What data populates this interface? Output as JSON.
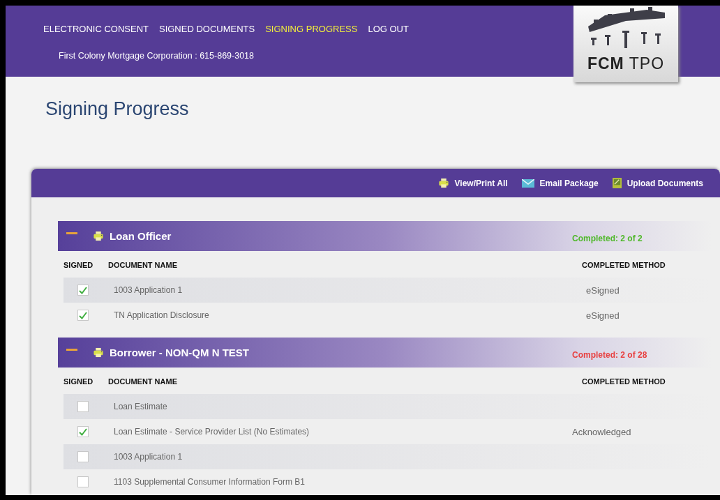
{
  "nav": [
    {
      "label": "ELECTRONIC CONSENT",
      "selected": false
    },
    {
      "label": "SIGNED DOCUMENTS",
      "selected": false
    },
    {
      "label": "SIGNING PROGRESS",
      "selected": true
    },
    {
      "label": "LOG OUT",
      "selected": false
    }
  ],
  "company_line": "First Colony Mortgage Corporation : 615-869-3018",
  "logo": {
    "text_bold": "FCM",
    "text": "TPO"
  },
  "page_title": "Signing Progress",
  "toolbar": [
    {
      "kind": "print",
      "label": "View/Print All"
    },
    {
      "kind": "email",
      "label": "Email Package"
    },
    {
      "kind": "upload",
      "label": "Upload Documents"
    }
  ],
  "sections": [
    {
      "title": "Loan Officer",
      "expanded": true,
      "status": "Completed: 2 of 2",
      "complete": true,
      "columns": [
        "SIGNED",
        "DOCUMENT NAME",
        "COMPLETED METHOD"
      ],
      "rows": [
        {
          "signed": true,
          "name": "1003 Application 1",
          "method": "eSigned"
        },
        {
          "signed": true,
          "name": "TN Application Disclosure",
          "method": "eSigned"
        }
      ]
    },
    {
      "title": "Borrower - NON-QM N TEST",
      "expanded": true,
      "status": "Completed: 2 of 28",
      "complete": false,
      "columns": [
        "SIGNED",
        "DOCUMENT NAME",
        "COMPLETED METHOD"
      ],
      "rows": [
        {
          "signed": false,
          "name": "Loan Estimate"
        },
        {
          "signed": true,
          "name": "Loan Estimate - Service Provider List (No Estimates)",
          "method": "Acknowledged"
        },
        {
          "signed": false,
          "name": "1003 Application 1"
        },
        {
          "signed": false,
          "name": "1103 Supplemental Consumer Information Form B1"
        }
      ]
    }
  ]
}
